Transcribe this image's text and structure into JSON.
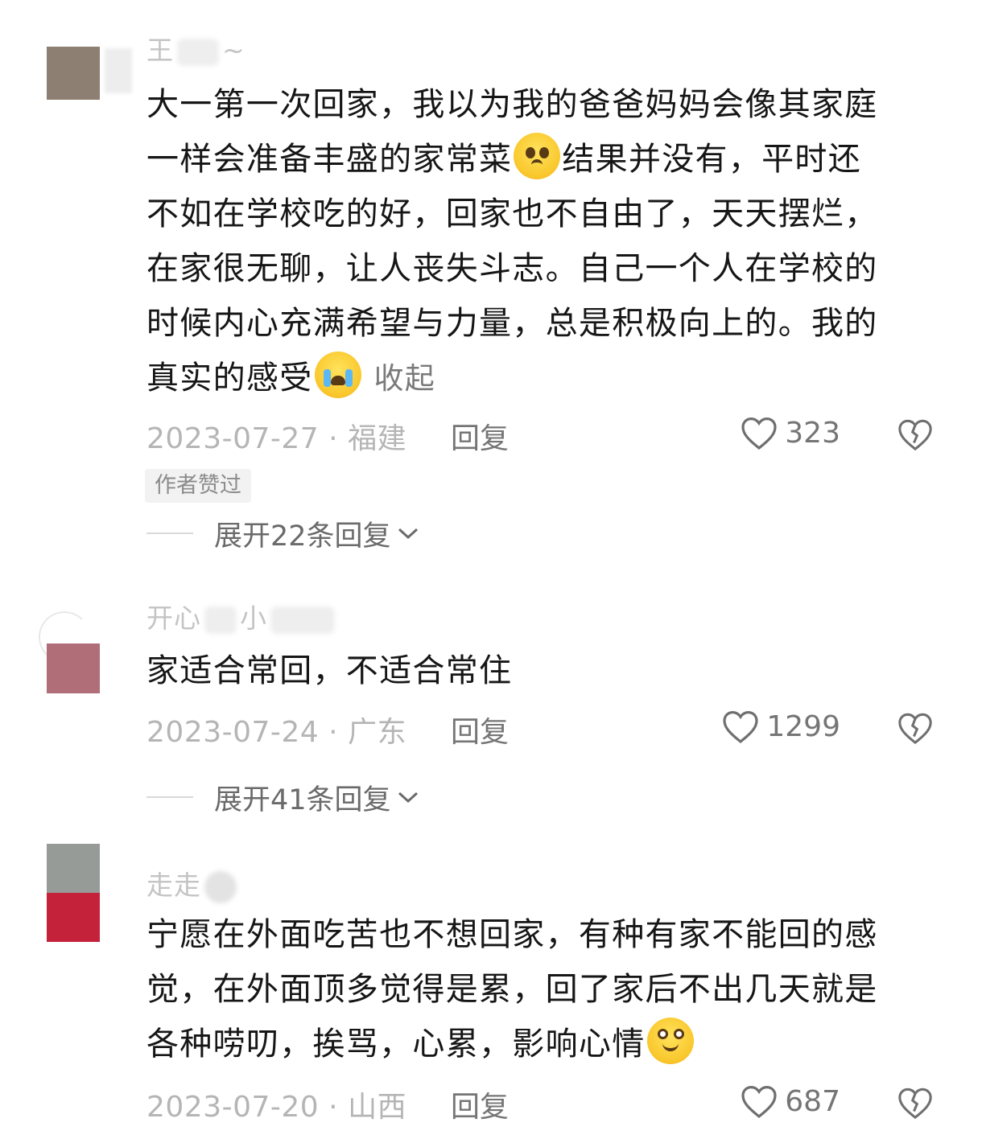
{
  "comments": [
    {
      "username": "王",
      "username_tail": "~",
      "text_lines": [
        "大一第一次回家，我以为我的爸爸妈妈会像其家庭",
        "一样会准备丰盛的家常菜",
        "结果并没有，平时还",
        "不如在学校吃的好，回家也不自由了，天天摆烂，",
        "在家很无聊，让人丧失斗志。自己一个人在学校的",
        "时候内心充满希望与力量，总是积极向上的。我的",
        "真实的感受"
      ],
      "emoji_1": "pleading-face-emoji",
      "emoji_2": "crying-face-emoji",
      "collapse_label": "收起",
      "date": "2023-07-27",
      "separator": "·",
      "region": "福建",
      "reply_label": "回复",
      "likes": "323",
      "badge": "作者赞过",
      "expand_label": "展开22条回复"
    },
    {
      "username": "开心",
      "username_mid": "小",
      "text_lines": [
        "家适合常回，不适合常住"
      ],
      "date": "2023-07-24",
      "separator": "·",
      "region": "广东",
      "reply_label": "回复",
      "likes": "1299",
      "expand_label": "展开41条回复"
    },
    {
      "username": "走走",
      "text_lines": [
        "宁愿在外面吃苦也不想回家，有种有家不能回的感",
        "觉，在外面顶多觉得是累，回了家后不出几天就是",
        "各种唠叨，挨骂，心累，影响心情"
      ],
      "emoji_1": "smiling-face-emoji",
      "date": "2023-07-20",
      "separator": "·",
      "region": "山西",
      "reply_label": "回复",
      "likes": "687"
    }
  ],
  "colors": {
    "text": "#161616",
    "meta": "#b5b5b5",
    "action": "#757575",
    "avatar1_top": "#8e7f73",
    "avatar2": "#b06e78",
    "avatar3_top": "#979b98",
    "avatar3_bottom": "#c4223a"
  }
}
